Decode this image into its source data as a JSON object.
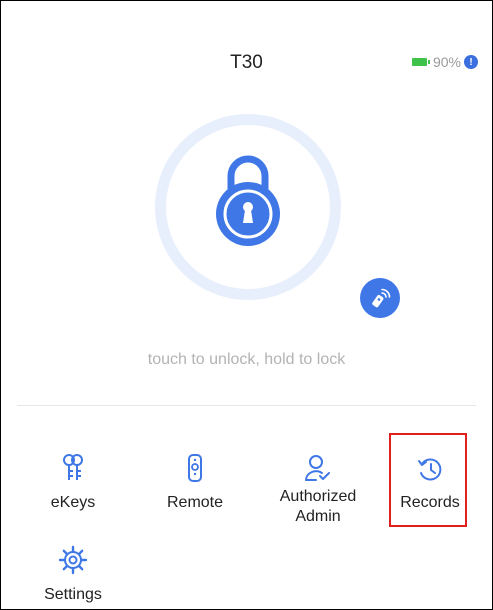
{
  "header": {
    "title": "T30",
    "battery_text": "90%",
    "info_glyph": "!"
  },
  "lock": {
    "hint": "touch to unlock, hold to lock",
    "lock_icon": "padlock-icon",
    "remote_icon": "remote-unlock-icon"
  },
  "menu": {
    "items": [
      {
        "label": "eKeys",
        "icon": "ekey-icon"
      },
      {
        "label": "Remote",
        "icon": "remote-icon"
      },
      {
        "label": "Authorized Admin",
        "icon": "admin-user-icon"
      },
      {
        "label": "Records",
        "icon": "history-icon"
      },
      {
        "label": "Settings",
        "icon": "settings-gear-icon"
      }
    ]
  },
  "colors": {
    "accent": "#3F78E6",
    "battery": "#3EC24A",
    "highlight": "#E0201F",
    "hint": "#B3B3B3"
  }
}
